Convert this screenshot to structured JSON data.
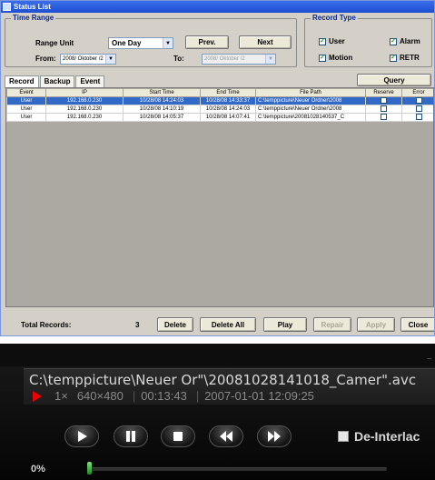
{
  "window": {
    "title": "Status List"
  },
  "time_range": {
    "legend": "Time Range",
    "range_unit_label": "Range Unit",
    "range_unit_value": "One Day",
    "prev_label": "Prev.",
    "next_label": "Next",
    "from_label": "From:",
    "from_value": "2008/ Oktober /2",
    "to_label": "To:",
    "to_value": "2008/ Oktober /2"
  },
  "record_type": {
    "legend": "Record Type",
    "options": [
      {
        "label": "User",
        "checked": true
      },
      {
        "label": "Alarm",
        "checked": true
      },
      {
        "label": "Motion",
        "checked": true
      },
      {
        "label": "RETR",
        "checked": true
      }
    ]
  },
  "tabs": [
    "Record",
    "Backup",
    "Event"
  ],
  "query_label": "Query",
  "table": {
    "columns": [
      "Event",
      "IP",
      "Start Time",
      "End Time",
      "File Path",
      "Reserve",
      "Error"
    ],
    "rows": [
      {
        "event": "User",
        "ip": "192.168.0.230",
        "start": "10/28/08 14:24:03",
        "end": "10/28/08 14:33:37",
        "path": "C:\\temppicture\\Neuer Ordner\\2008",
        "selected": true
      },
      {
        "event": "User",
        "ip": "192.168.0.230",
        "start": "10/28/08 14:10:19",
        "end": "10/28/08 14:24:03",
        "path": "C:\\temppicture\\Neuer Ordner\\2008",
        "selected": false
      },
      {
        "event": "User",
        "ip": "192.168.0.230",
        "start": "10/28/08 14:05:37",
        "end": "10/28/08 14:07:41",
        "path": "C:\\temppicture\\20081028140537_C",
        "selected": false
      }
    ]
  },
  "bottom": {
    "total_label": "Total Records:",
    "total_value": "3",
    "delete_label": "Delete",
    "delete_all_label": "Delete All",
    "play_label": "Play",
    "repair_label": "Repair",
    "apply_label": "Apply",
    "close_label": "Close"
  },
  "player": {
    "filename": "C:\\temppicture\\Neuer Or\"\\20081028141018_Camer\".avc",
    "speed": "1×",
    "resolution": "640×480",
    "duration": "00:13:43",
    "datetime": "2007-01-01 12:09:25",
    "deinterlace_label": "De-Interlac",
    "progress_text": "0%",
    "progress_fraction": 0.0,
    "colors": {
      "accent_red": "#e00000",
      "progress_green": "#2ea02e"
    }
  }
}
